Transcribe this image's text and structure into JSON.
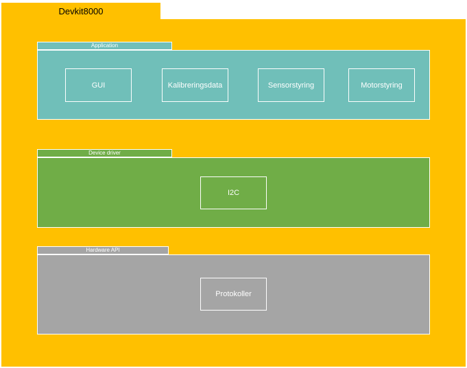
{
  "colors": {
    "container": "#FFC000",
    "application": "#70BFB9",
    "device_driver": "#70AD47",
    "hardware_api": "#A5A5A5",
    "outline": "#FFFFFF"
  },
  "diagram": {
    "title": "Devkit8000",
    "packages": [
      {
        "label": "Application",
        "components": [
          "GUI",
          "Kalibreringsdata",
          "Sensorstyring",
          "Motorstyring"
        ]
      },
      {
        "label": "Device driver",
        "components": [
          "I2C"
        ]
      },
      {
        "label": "Hardware API",
        "components": [
          "Protokoller"
        ]
      }
    ]
  }
}
